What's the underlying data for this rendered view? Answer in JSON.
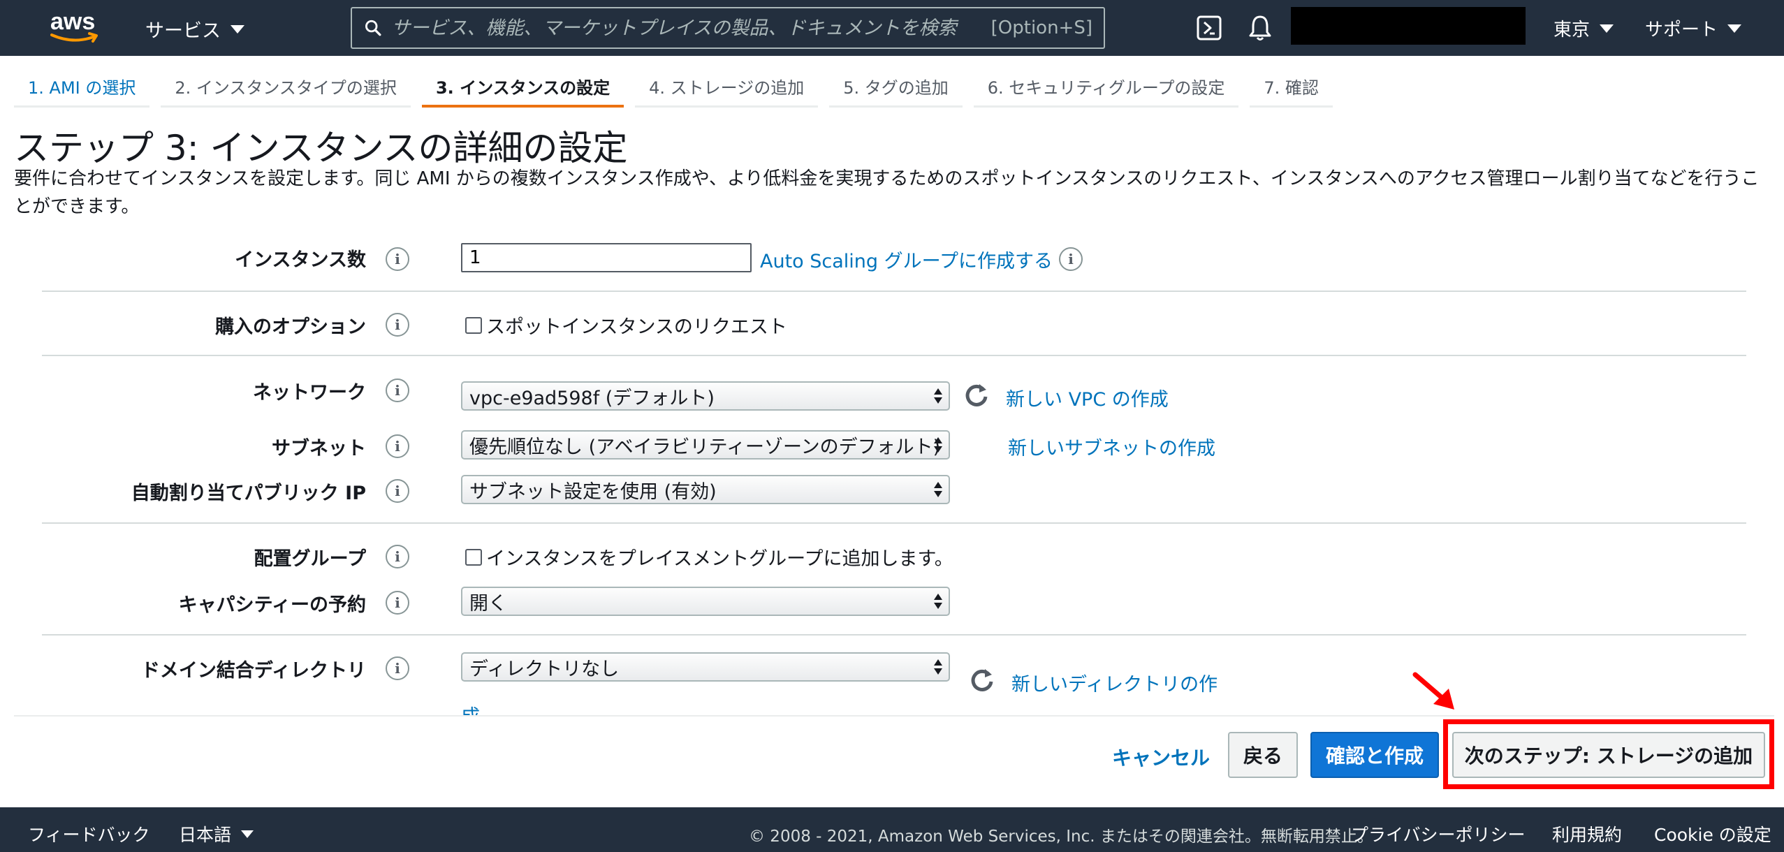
{
  "nav": {
    "logo_text": "aws",
    "services_label": "サービス",
    "search_placeholder": "サービス、機能、マーケットプレイスの製品、ドキュメントを検索",
    "search_hint": "[Option+S]",
    "region_label": "東京",
    "support_label": "サポート"
  },
  "steps": [
    {
      "label": "1. AMI の選択"
    },
    {
      "label": "2. インスタンスタイプの選択"
    },
    {
      "label": "3. インスタンスの設定"
    },
    {
      "label": "4. ストレージの追加"
    },
    {
      "label": "5. タグの追加"
    },
    {
      "label": "6. セキュリティグループの設定"
    },
    {
      "label": "7. 確認"
    }
  ],
  "page": {
    "title": "ステップ 3: インスタンスの詳細の設定",
    "description": "要件に合わせてインスタンスを設定します。同じ AMI からの複数インスタンス作成や、より低料金を実現するためのスポットインスタンスのリクエスト、インスタンスへのアクセス管理ロール割り当てなどを行うことができます。"
  },
  "form": {
    "info_glyph": "i",
    "instance_count": {
      "label": "インスタンス数",
      "value": "1",
      "link": "Auto Scaling グループに作成する"
    },
    "purchase": {
      "label": "購入のオプション",
      "checkbox": "スポットインスタンスのリクエスト"
    },
    "network": {
      "label": "ネットワーク",
      "value": "vpc-e9ad598f (デフォルト)",
      "link": "新しい VPC の作成"
    },
    "subnet": {
      "label": "サブネット",
      "value": "優先順位なし (アベイラビリティーゾーンのデフォルト)",
      "link": "新しいサブネットの作成"
    },
    "public_ip": {
      "label": "自動割り当てパブリック IP",
      "value": "サブネット設定を使用 (有効)"
    },
    "placement": {
      "label": "配置グループ",
      "checkbox": "インスタンスをプレイスメントグループに追加します。"
    },
    "capacity": {
      "label": "キャパシティーの予約",
      "value": "開く"
    },
    "domain": {
      "label": "ドメイン結合ディレクトリ",
      "value": "ディレクトリなし",
      "link_line1": "新しいディレクトリの作",
      "link_line2": "成"
    }
  },
  "actions": {
    "cancel": "キャンセル",
    "back": "戻る",
    "review": "確認と作成",
    "next": "次のステップ: ストレージの追加"
  },
  "footer": {
    "feedback": "フィードバック",
    "language": "日本語",
    "copyright": "© 2008 - 2021, Amazon Web Services, Inc. またはその関連会社。無断転用禁止。",
    "privacy": "プライバシーポリシー",
    "terms": "利用規約",
    "cookie": "Cookie の設定"
  },
  "colors": {
    "nav_bg": "#232f3e",
    "link": "#0073bb",
    "active_tab": "#ec7211",
    "primary_button": "#0f75d6",
    "annotation": "#ff0000"
  },
  "icons": [
    "search-icon",
    "cloudshell-icon",
    "bell-icon",
    "info-icon",
    "refresh-icon",
    "caret-down-icon",
    "annotation-arrow-icon"
  ]
}
